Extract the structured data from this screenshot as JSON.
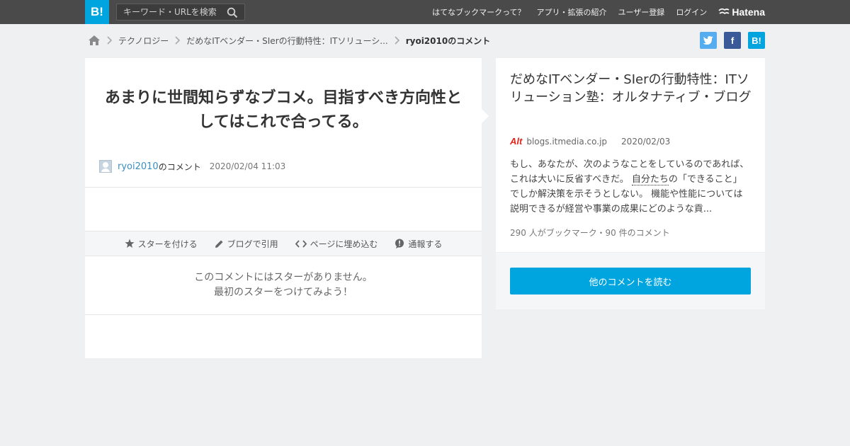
{
  "header": {
    "logo_text": "B!",
    "search_placeholder": "キーワード・URLを検索",
    "nav": [
      "はてなブックマークって？",
      "アプリ・拡張の紹介",
      "ユーザー登録",
      "ログイン"
    ],
    "brand": "Hatena"
  },
  "breadcrumb": {
    "items": [
      "テクノロジー",
      "だめなITベンダー・SIerの行動特性：ITソリューシ..."
    ],
    "current": "ryoi2010のコメント"
  },
  "share": {
    "twitter": "twitter-icon",
    "facebook_label": "f",
    "hatebu_label": "B!"
  },
  "comment": {
    "text": "あまりに世間知らずなブコメ。目指すべき方向性としてはこれで合ってる。",
    "user": "ryoi2010",
    "user_suffix": "のコメント",
    "date": "2020/02/04 11:03"
  },
  "actions": {
    "star": "スターを付ける",
    "blog": "ブログで引用",
    "embed": "ページに埋め込む",
    "report": "通報する"
  },
  "stars": {
    "line1": "このコメントにはスターがありません。",
    "line2": "最初のスターをつけてみよう！"
  },
  "entry": {
    "title": "だめなITベンダー・SIerの行動特性：ITソリューション塾：オルタナティブ・ブログ",
    "favicon_text": "Alt",
    "domain": "blogs.itmedia.co.jp",
    "date": "2020/02/03",
    "desc_before": "もし、あなたが、次のようなことをしているのであれば、これは大いに反省すべきだ。 ",
    "desc_keyword": "自分たち",
    "desc_after": "の「できること」でしか解決策を示そうとしない。 機能や性能については説明できるが経営や事業の成果にどのような貢...",
    "counts": "290 人がブックマーク・90 件のコメント",
    "read_button": "他のコメントを読む"
  },
  "colors": {
    "accent": "#00a4de",
    "topbar": "#4a4a4a",
    "twitter": "#55acee",
    "facebook": "#3b5998",
    "favicon": "#e2241b"
  }
}
